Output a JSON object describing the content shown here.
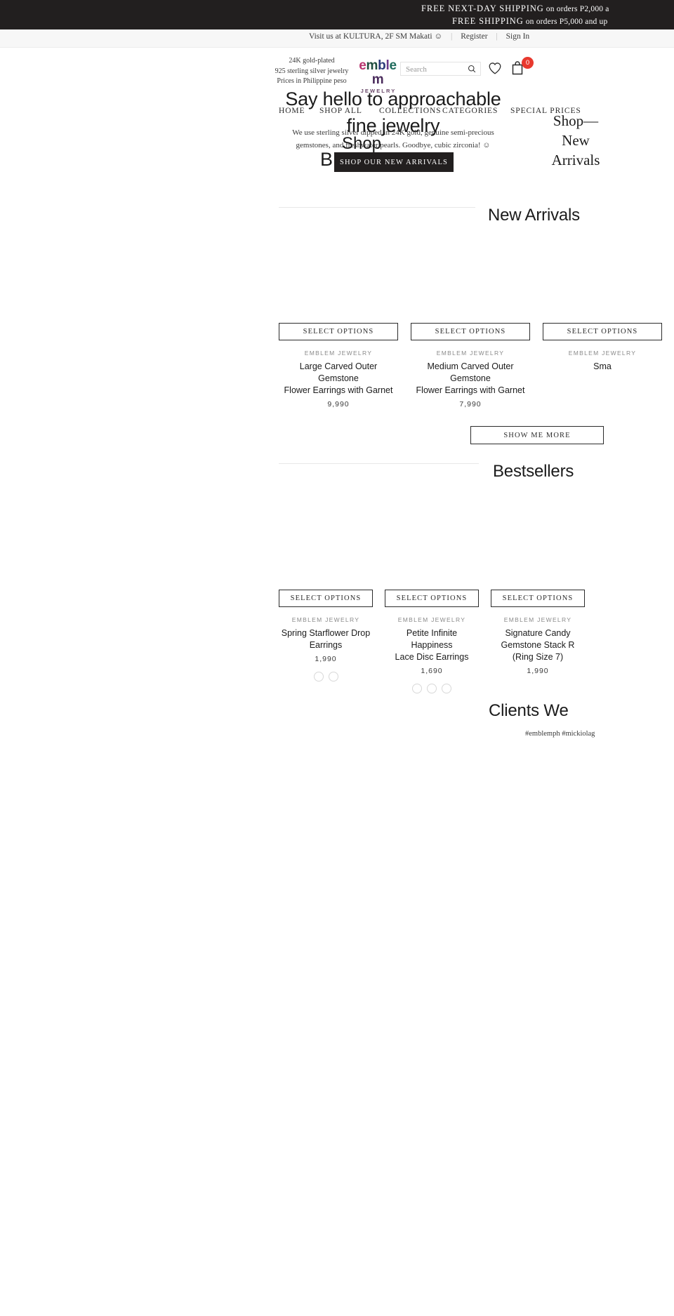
{
  "announcement": {
    "line1_strong": "FREE NEXT-DAY SHIPPING",
    "line1_rest": " on orders P2,000 a",
    "line2_strong": "FREE SHIPPING",
    "line2_rest": " on orders P5,000 and up"
  },
  "utility": {
    "visit": "Visit us at KULTURA, 2F SM Makati ☺",
    "register": "Register",
    "signin": "Sign In"
  },
  "header": {
    "tagline_1": "24K gold-plated",
    "tagline_2": "925 sterling silver jewelry",
    "tagline_3": "Prices in Philippine peso",
    "logo_letters": [
      "e",
      "m",
      "b",
      "l",
      "e",
      "m"
    ],
    "logo_colors": [
      "#b8356f",
      "#1f4d3f",
      "#2b3a7a",
      "#6b3a8a",
      "#1f6b5c",
      "#4a2b5c"
    ],
    "logo_sub": "JEWELRY",
    "search_placeholder": "Search",
    "search_value": "",
    "cart_count": "0"
  },
  "nav": [
    {
      "label": "HOME"
    },
    {
      "label": "SHOP ALL"
    },
    {
      "label": "COLLECTIONS"
    },
    {
      "label": "CATEGORIES"
    },
    {
      "label": "SPECIAL PRICES"
    }
  ],
  "hero": {
    "headline_1": "Say hello to approachable",
    "headline_2": "fine jewelry",
    "sub_1": "We use sterling silver dipped in 24K gold, genuine semi-precious",
    "sub_2": "gemstones, and freshwater pearls. Goodbye, cubic zirconia! ☺",
    "word_shop": "Shop",
    "word_b": "B",
    "cta": "SHOP OUR NEW ARRIVALS",
    "aside_1": "Shop—",
    "aside_2": "New",
    "aside_3": "Arrivals"
  },
  "sections": {
    "new_arrivals_title": "New Arrivals",
    "bestsellers_title": "Bestsellers",
    "clients_title": "Clients We",
    "show_more": "SHOW ME MORE",
    "hashtags": "#emblemph #mickiolag"
  },
  "brand_label": "EMBLEM JEWELRY",
  "select_options_label": "SELECT OPTIONS",
  "new_arrivals": [
    {
      "brand": "EMBLEM JEWELRY",
      "title_1": "Large Carved Outer Gemstone",
      "title_2": "Flower Earrings with Garnet",
      "price": "9,990",
      "swatches": []
    },
    {
      "brand": "EMBLEM JEWELRY",
      "title_1": "Medium Carved Outer Gemstone",
      "title_2": "Flower Earrings with Garnet",
      "price": "7,990",
      "swatches": []
    },
    {
      "brand": "EMBLEM JEWELRY",
      "title_1": "Sma",
      "title_2": "",
      "price": "",
      "swatches": []
    }
  ],
  "bestsellers": [
    {
      "brand": "EMBLEM JEWELRY",
      "title_1": "Spring Starflower Drop",
      "title_2": "Earrings",
      "title_3": "",
      "price": "1,990",
      "swatches": [
        "#ffffff",
        "#ffffff"
      ]
    },
    {
      "brand": "EMBLEM JEWELRY",
      "title_1": "Petite Infinite Happiness",
      "title_2": "Lace Disc Earrings",
      "title_3": "",
      "price": "1,690",
      "swatches": [
        "#ffffff",
        "#ffffff",
        "#ffffff"
      ]
    },
    {
      "brand": "EMBLEM JEWELRY",
      "title_1": "Signature Candy",
      "title_2": "Gemstone Stack R",
      "title_3": "(Ring Size 7)",
      "price": "1,990",
      "swatches": []
    }
  ]
}
